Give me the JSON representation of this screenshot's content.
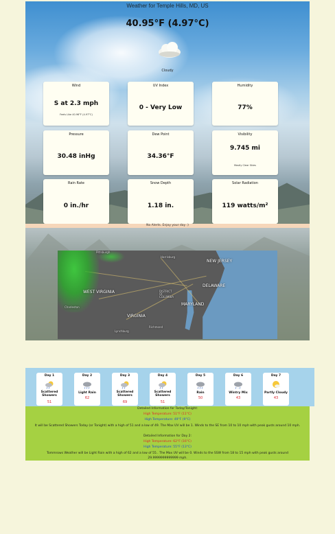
{
  "header": {
    "title": "Weather for Temple Hills, MD, US",
    "temperature": "40.95°F (4.97°C)",
    "condition": "Cloudy",
    "condition_icon": "cloud-icon"
  },
  "cards": {
    "wind": {
      "label": "Wind",
      "value": "S at 2.3 mph",
      "sub": "Feels Like 40.96°F (4.97°C)"
    },
    "uv": {
      "label": "UV Index",
      "value": "0 - Very Low"
    },
    "humidity": {
      "label": "Humidity",
      "value": "77%"
    },
    "pressure": {
      "label": "Pressure",
      "value": "30.48 inHg"
    },
    "dewpoint": {
      "label": "Dew Point",
      "value": "34.36°F"
    },
    "visibility": {
      "label": "Visibility",
      "value": "9.745 mi",
      "sub": "Mostly Clear Skies"
    },
    "rain": {
      "label": "Rain Rate",
      "value": "0 in./hr"
    },
    "snow": {
      "label": "Snow Depth",
      "value": "1.18 in."
    },
    "solar": {
      "label": "Solar Radiation",
      "value": "119 watts/m²"
    }
  },
  "alerts": "No Alerts. Enjoy your day :)",
  "map": {
    "labels": {
      "pittsburgh": "Pittsburgh",
      "harrisburg": "Harrisburg",
      "new_jersey": "NEW JERSEY",
      "west_virginia": "WEST VIRGINIA",
      "delaware": "DELAWARE",
      "dc": "DISTRICT OF COLUMBIA",
      "maryland": "MARYLAND",
      "charleston": "Charleston",
      "virginia": "VIRGINIA",
      "richmond": "Richmond",
      "lynchburg": "Lynchburg"
    },
    "colors": {
      "radar": "#3cd23c",
      "ocean": "#6b9ac1",
      "land": "#5a5a5a"
    }
  },
  "forecast": [
    {
      "day": "Day 1",
      "desc": "Scattered Showers",
      "high": "51",
      "icon": "sun-rain-icon"
    },
    {
      "day": "Day 2",
      "desc": "Light Rain",
      "high": "62",
      "icon": "rain-cloud-icon"
    },
    {
      "day": "Day 3",
      "desc": "Scattered Showers",
      "high": "69",
      "icon": "sun-rain-icon"
    },
    {
      "day": "Day 4",
      "desc": "Scattered Showers",
      "high": "51",
      "icon": "sun-rain-icon"
    },
    {
      "day": "Day 5",
      "desc": "Rain",
      "high": "50",
      "icon": "rain-cloud-icon"
    },
    {
      "day": "Day 6",
      "desc": "Wintry Mix",
      "high": "43",
      "icon": "wintry-mix-icon"
    },
    {
      "day": "Day 7",
      "desc": "Partly Cloudy",
      "high": "43",
      "icon": "partly-cloudy-icon"
    }
  ],
  "details": {
    "today_heading": "Detailed Information for Today/Tonight:",
    "today_high": "High Temperature: 51°F (11°C)",
    "today_low": "High Temperature: 49°F (9°C)",
    "today_text": "It will be Scattered Showers Today (or Tonight) with a high of 51 and a low of 49. The Max UV will be 1. Winds to the SE from 10 to 10 mph with peak gusts around 10 mph.",
    "day2_heading": "Detailed Information for Day 2:",
    "day2_high": "High Temperature: 62°F (16°C)",
    "day2_low": "High Temperature: 55°F (13°C)",
    "day2_text": "Tommrows Weather will be Light Rain with a high of 62 and a low of 55.. The Max UV will be 0. Winds to the SSW from 18 to 15 mph with peak gusts around 29.9999999999999 mph.",
    "colors": {
      "high": "#e0262a",
      "low": "#1e4fd0",
      "background": "#a5d142"
    }
  }
}
